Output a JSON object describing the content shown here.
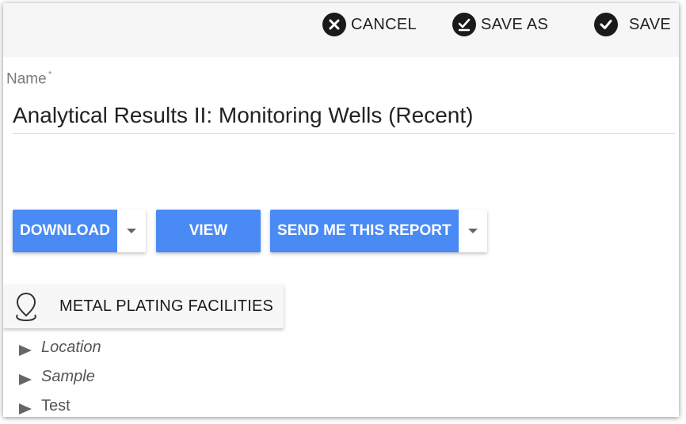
{
  "toolbar": {
    "cancel_label": "CANCEL",
    "save_as_label": "SAVE AS",
    "save_label": "SAVE"
  },
  "name_field": {
    "label": "Name",
    "required_marker": "*",
    "value": "Analytical Results II: Monitoring Wells (Recent)"
  },
  "actions": {
    "download_label": "DOWNLOAD",
    "view_label": "VIEW",
    "send_label": "SEND ME THIS REPORT"
  },
  "layer": {
    "label": "METAL PLATING FACILITIES"
  },
  "tree": {
    "items": [
      {
        "label": "Location"
      },
      {
        "label": "Sample"
      },
      {
        "label": "Test"
      }
    ]
  },
  "colors": {
    "accent": "#4a8af4",
    "toolbar_bg": "#f6f6f6"
  }
}
